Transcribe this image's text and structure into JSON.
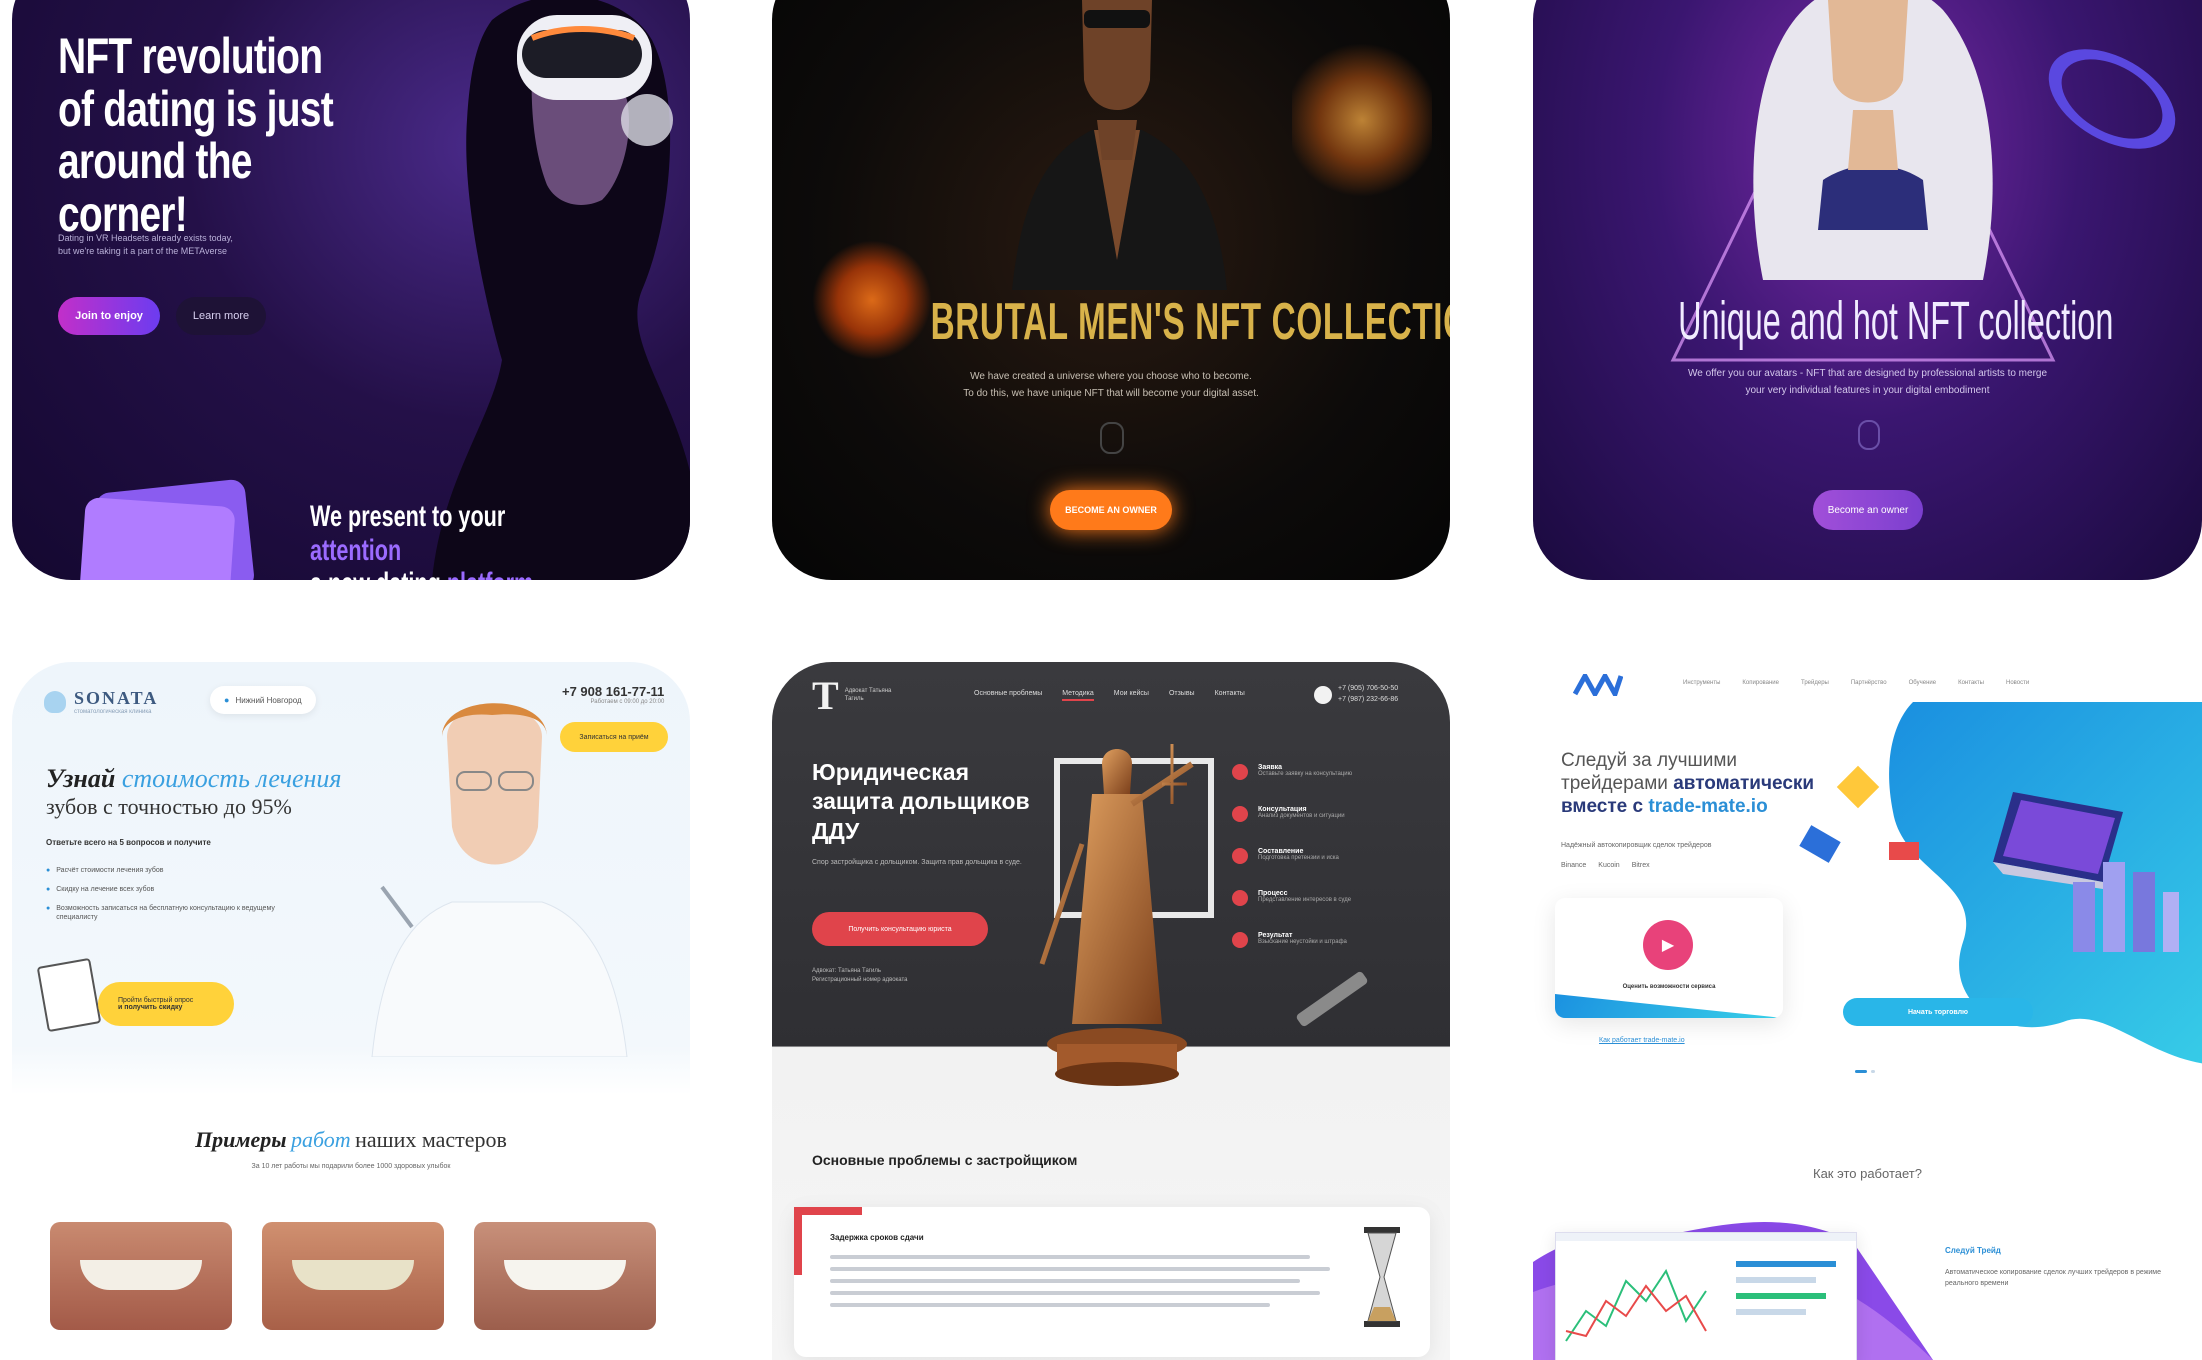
{
  "colors": {
    "nft1_bg": "#241048",
    "nft1_accent": "#9b6bff",
    "nft2_bg": "#0d0b0a",
    "nft2_gold": "#d8b24a",
    "nft2_button": "#ff7a1a",
    "nft3_bg": "#3a1670",
    "nft3_button": "#a14fd9",
    "dental_blue": "#2b8fd6",
    "dental_yellow": "#ffd23a",
    "legal_red": "#e0444b",
    "legal_dark": "#333337",
    "trade_blue": "#2b6fd9",
    "trade_cyan": "#29b6e8"
  },
  "cards": {
    "nft_dating": {
      "headline_1": "NFT revolution",
      "headline_2": "of dating is just",
      "headline_3": "around the corner!",
      "sub_1": "Dating in VR Headsets already exists today,",
      "sub_2": "but we're taking it a part of the METAverse",
      "primary_button": "Join to enjoy",
      "secondary_button": "Learn more",
      "bottom_1a": "We present to your",
      "bottom_1b": "attention",
      "bottom_2a": "a new dating",
      "bottom_2b": "platform"
    },
    "brutal": {
      "title": "BRUTAL MEN'S NFT COLLECTION",
      "sub_1": "We have created a universe where you choose who to become.",
      "sub_2": "To do this, we have unique NFT that will become your digital asset.",
      "button": "BECOME AN OWNER"
    },
    "unique": {
      "title": "Unique and hot NFT collection",
      "sub_1": "We offer you our avatars - NFT that are designed by professional artists to merge",
      "sub_2": "your very individual features in your digital embodiment",
      "button": "Become an owner"
    },
    "dental": {
      "logo": "SONATA",
      "logo_sub": "стоматологическая клиника",
      "city": "Нижний Новгород",
      "phone": "+7 908 161-77-11",
      "phone_sub": "Работаем с 09:00 до 20:00",
      "callback": "Записаться на приём",
      "headline_1a": "Узнай",
      "headline_1b": "стоимость лечения",
      "headline_2": "зубов с точностью до 95%",
      "lead": "Ответьте всего на 5 вопросов и получите",
      "bullet_1": "Расчёт стоимости лечения зубов",
      "bullet_2": "Скидку на лечение всех зубов",
      "bullet_3": "Возможность записаться на бесплатную консультацию к ведущему специалисту",
      "cta_1": "Пройти быстрый опрос",
      "cta_2": "и получить скидку",
      "examples_a": "Примеры",
      "examples_b": "работ",
      "examples_c": "наших мастеров",
      "examples_sub": "За 10 лет работы мы подарили более 1000 здоровых улыбок"
    },
    "legal": {
      "logo_letter": "T",
      "logo_text": "Адвокат Татьяна Тагиль",
      "nav": [
        "Основные проблемы",
        "Методика",
        "Мои кейсы",
        "Отзывы",
        "Контакты"
      ],
      "phone_1": "+7 (905) 706-50-50",
      "phone_2": "+7 (987) 232-66-86",
      "headline_1": "Юридическая",
      "headline_2": "защита дольщиков",
      "headline_3": "ДДУ",
      "desc": "Спор застройщика с дольщиком. Защита прав дольщика в суде.",
      "button": "Получить консультацию юриста",
      "address_1": "Адвокат: Татьяна Тагиль",
      "address_2": "Регистрационный номер адвоката",
      "steps": [
        {
          "title": "Заявка",
          "text": "Оставьте заявку на консультацию"
        },
        {
          "title": "Консультация",
          "text": "Анализ документов и ситуации"
        },
        {
          "title": "Составление",
          "text": "Подготовка претензии и иска"
        },
        {
          "title": "Процесс",
          "text": "Представление интересов в суде"
        },
        {
          "title": "Результат",
          "text": "Взыскание неустойки и штрафа"
        }
      ],
      "section_title": "Основные проблемы с застройщиком",
      "problem_title": "Задержка сроков сдачи"
    },
    "trade": {
      "nav": [
        "Инструменты",
        "Копирование",
        "Трейдеры",
        "Партнёрство",
        "Обучение",
        "Контакты",
        "Новости"
      ],
      "headline_1": "Следуй за лучшими",
      "headline_2a": "трейдерами",
      "headline_2b": "автоматически",
      "headline_3a": "вместе с",
      "headline_3b": "trade-mate.io",
      "sub": "Надёжный автокопировщик сделок трейдеров",
      "exchanges": [
        "Binance",
        "Kucoin",
        "Bitrex"
      ],
      "video_caption": "Оценить возможности сервиса",
      "link": "Как работает trade-mate.io",
      "button": "Начать торговлю",
      "how": "Как это работает?",
      "step_title": "Следуй Трейд",
      "step_text": "Автоматическое копирование сделок лучших трейдеров в режиме реального времени"
    }
  }
}
